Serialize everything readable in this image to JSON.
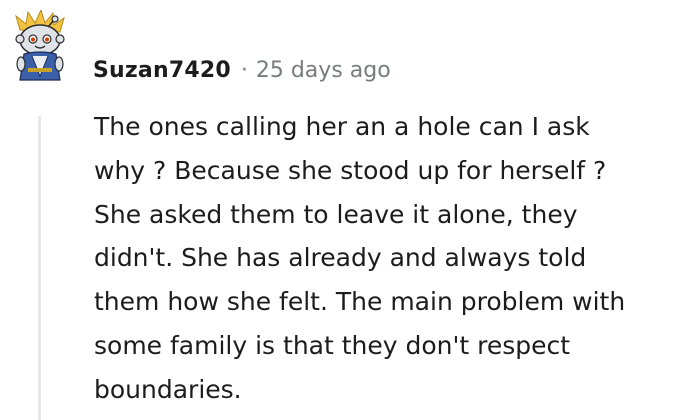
{
  "comment": {
    "username": "Suzan7420",
    "separator": "·",
    "timestamp": "25 days ago",
    "body_lines": [
      "The ones calling her an a hole can I ask",
      "why ? Because she stood up for herself ?",
      "She asked them to leave it alone, they",
      "didn't. She has already and always told",
      "them how she felt. The main problem with",
      "some family is that they don't respect",
      "boundaries."
    ],
    "avatar_icon": "snoo-avatar-icon"
  },
  "colors": {
    "text": "#1c1c1c",
    "meta": "#787c7e",
    "thread_line": "#e6e8ea"
  }
}
